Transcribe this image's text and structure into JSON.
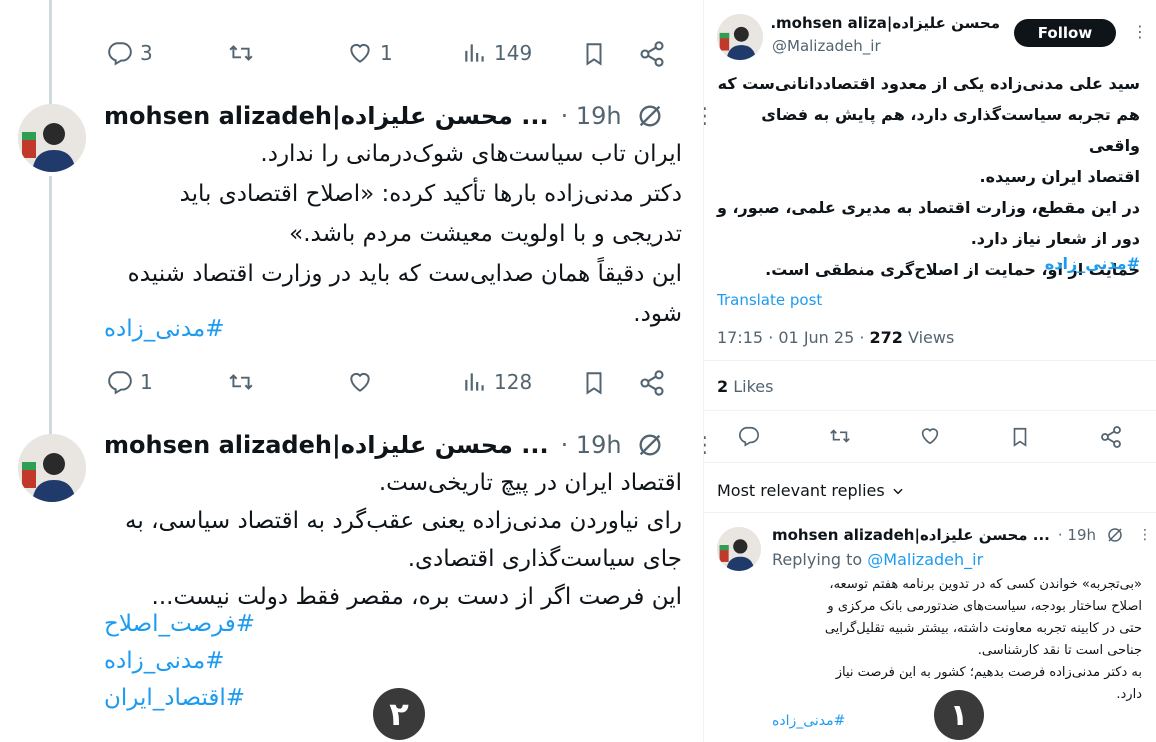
{
  "left": {
    "top_actions": {
      "replies": "3",
      "likes": "1",
      "views": "149"
    },
    "tweet2": {
      "name": "mohsen alizadeh|محسن علیزاده ...",
      "time": "· 19h",
      "lines": [
        "ایران تاب سیاست‌های شوک‌درمانی را ندارد.",
        "دکتر مدنی‌زاده بارها تأکید کرده: «اصلاح اقتصادی باید",
        "تدریجی و با اولویت معیشت مردم باشد.»",
        "این دقیقاً همان صدایی‌ست که باید در وزارت اقتصاد شنیده",
        "شود."
      ],
      "hashtags": [
        "#مدنی_زاده"
      ],
      "actions": {
        "replies": "1",
        "views": "128"
      }
    },
    "tweet3": {
      "name": "mohsen alizadeh|محسن علیزاده ...",
      "time": "· 19h",
      "lines": [
        "اقتصاد ایران در پیچ تاریخی‌ست.",
        "رای نیاوردن مدنی‌زاده یعنی عقب‌گرد به اقتصاد سیاسی، به",
        "جای سیاست‌گذاری اقتصادی.",
        "این فرصت اگر از دست بره، مقصر فقط دولت نیست..."
      ],
      "hashtags": [
        "#فرصت_اصلاح",
        "#مدنی_زاده",
        "#اقتصاد_ایران"
      ]
    },
    "badge": "۲"
  },
  "right": {
    "author": {
      "name": "محسن علیزاده|mohsen aliza...",
      "handle": "@Malizadeh_ir"
    },
    "follow_label": "Follow",
    "lines": [
      "سید علی مدنی‌زاده یکی از معدود اقتصاددانانی‌ست که",
      "هم تجربه سیاست‌گذاری دارد، هم پایش به فضای واقعی",
      "اقتصاد ایران رسیده.",
      "در این مقطع، وزارت اقتصاد به مدیری علمی، صبور، و",
      "دور از شعار نیاز دارد.",
      "حمایت از او، حمایت از اصلاح‌گری منطقی است."
    ],
    "hashtag": "#مدنی_زاده",
    "translate": "Translate post",
    "meta": {
      "time": "17:15 · 01 Jun 25 · ",
      "views_count": "272",
      "views_label": " Views"
    },
    "likes": {
      "count": "2",
      "label": " Likes"
    },
    "replies_sort": "Most relevant replies",
    "reply": {
      "name": "mohsen alizadeh|محسن علیزاده ...",
      "time": "· 19h",
      "replying_prefix": "Replying to ",
      "replying_handle": "@Malizadeh_ir",
      "lines": [
        "«بی‌تجربه» خواندن کسی که در تدوین برنامه هفتم توسعه،",
        "اصلاح ساختار بودجه، سیاست‌های ضدتورمی بانک مرکزی و",
        "حتی در کابینه تجربه معاونت داشته، بیشتر شبیه تقلیل‌گرایی",
        "جناحی است تا نقد کارشناسی.",
        "به دکتر مدنی‌زاده فرصت بدهیم؛ کشور به این فرصت نیاز",
        "دارد."
      ],
      "hashtag": "#مدنی_زاده"
    },
    "badge": "۱"
  }
}
